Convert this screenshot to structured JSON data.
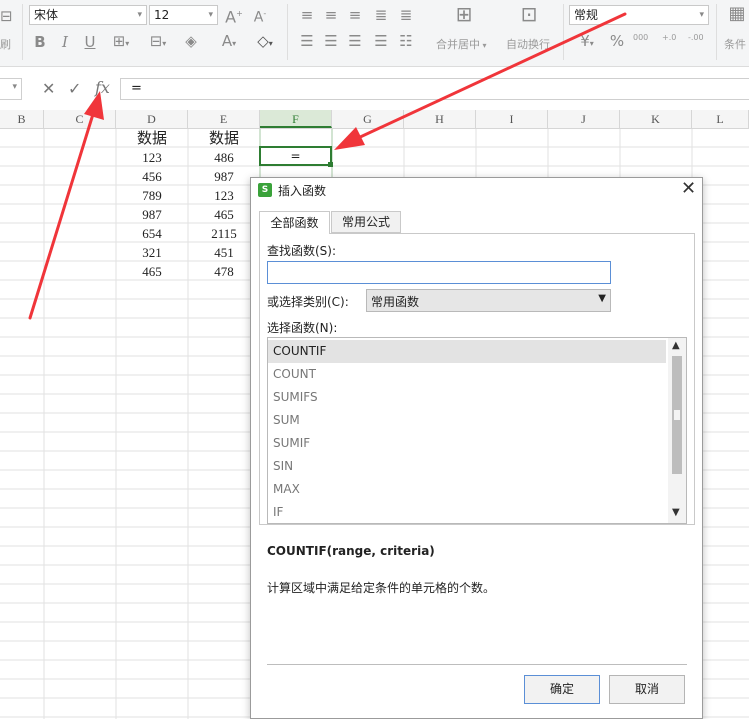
{
  "ribbon": {
    "font_name": "宋体",
    "font_size": "12",
    "number_format": "常规",
    "left_cut_label": "刷",
    "merge_center_label": "合并居中",
    "wrap_text_label": "自动换行",
    "conditional_label": "条件",
    "percent_symbol": "%",
    "thousands_label": "000",
    "inc_decimal_label": "+.0",
    "dec_decimal_label": "-.00"
  },
  "formula_bar": {
    "cancel_symbol": "✕",
    "confirm_symbol": "✓",
    "fx_label": "fx",
    "value": "="
  },
  "sheet": {
    "columns": [
      "B",
      "C",
      "D",
      "E",
      "F",
      "G",
      "H",
      "I",
      "J",
      "K",
      "L"
    ],
    "selected_column": "F",
    "headers": {
      "D": "数据",
      "E": "数据"
    },
    "col_d": [
      "123",
      "456",
      "789",
      "987",
      "654",
      "321",
      "465"
    ],
    "col_e": [
      "486",
      "987",
      "123",
      "465",
      "2115",
      "451",
      "478"
    ],
    "active_cell_value": "="
  },
  "dialog": {
    "title": "插入函数",
    "tabs": [
      "全部函数",
      "常用公式"
    ],
    "search_label": "查找函数(S):",
    "search_value": "",
    "category_label": "或选择类别(C):",
    "category_value": "常用函数",
    "select_label": "选择函数(N):",
    "functions": [
      "COUNTIF",
      "COUNT",
      "SUMIFS",
      "SUM",
      "SUMIF",
      "SIN",
      "MAX",
      "IF"
    ],
    "selected_function": "COUNTIF",
    "signature": "COUNTIF(range, criteria)",
    "description": "计算区域中满足给定条件的单元格的个数。",
    "ok_label": "确定",
    "cancel_label": "取消"
  },
  "colors": {
    "accent_green": "#2e7d32",
    "arrow_red": "#f0353a",
    "primary_border": "#5b8fd6"
  }
}
